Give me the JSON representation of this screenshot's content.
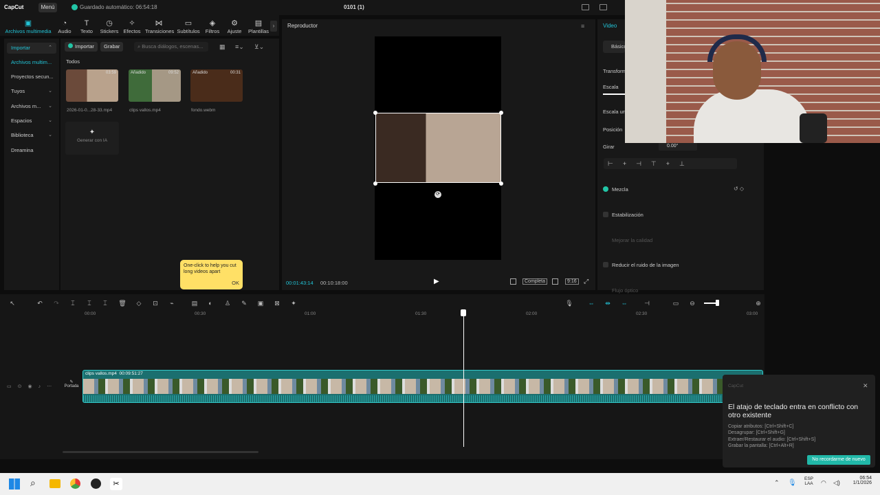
{
  "window": {
    "app_name": "CapCut",
    "menu_label": "Menú",
    "autosave": "Guardado automático: 06:54:18",
    "project_title": "0101 (1)"
  },
  "toolbar": {
    "items": [
      {
        "label": "Archivos multimedia",
        "icon": "media-icon"
      },
      {
        "label": "Audio",
        "icon": "audio-icon"
      },
      {
        "label": "Texto",
        "icon": "text-icon"
      },
      {
        "label": "Stickers",
        "icon": "sticker-icon"
      },
      {
        "label": "Efectos",
        "icon": "effects-icon"
      },
      {
        "label": "Transiciones",
        "icon": "transition-icon"
      },
      {
        "label": "Subtítulos",
        "icon": "subtitles-icon"
      },
      {
        "label": "Filtros",
        "icon": "filter-icon"
      },
      {
        "label": "Ajuste",
        "icon": "adjust-icon"
      },
      {
        "label": "Plantillas",
        "icon": "templates-icon"
      }
    ]
  },
  "sidebar": {
    "items": [
      {
        "label": "Importar"
      },
      {
        "label": "Archivos multim..."
      },
      {
        "label": "Proyectos secun..."
      },
      {
        "label": "Tuyos"
      },
      {
        "label": "Archivos m..."
      },
      {
        "label": "Espacios"
      },
      {
        "label": "Biblioteca"
      },
      {
        "label": "Dreamina"
      }
    ]
  },
  "media": {
    "import_label": "Importar",
    "record_label": "Grabar",
    "search_placeholder": "Busca diálogos, escenas...",
    "filter_label": "Todos",
    "files": [
      {
        "name": "2026-01-0...28-33.mp4",
        "tag": "",
        "duration": "03:59"
      },
      {
        "name": "clips vallos.mp4",
        "tag": "Añadido",
        "duration": "09:52"
      },
      {
        "name": "fondo.webm",
        "tag": "Añadido",
        "duration": "00:31"
      }
    ],
    "ai_label": "Generar con IA"
  },
  "player": {
    "title": "Reproductor",
    "current_time": "00:01:43:14",
    "total_time": "00:10:18:00",
    "complete_label": "Completa",
    "ratio_label": "9:16"
  },
  "right_panel": {
    "tab": "Video",
    "basic_tab": "Básico",
    "transform_label": "Transform",
    "scale_label": "Escala",
    "scale_uniform_label": "Escala un",
    "position_label": "Posición",
    "rotate_label": "Girar",
    "rotate_value": "0.00°",
    "blend_label": "Mezcla",
    "stabilize_label": "Estabilización",
    "improve_label": "Mejorar la calidad",
    "noise_label": "Reducir el ruido de la imagen",
    "flow_label": "Flujo óptico"
  },
  "timeline": {
    "ruler": [
      "00:00",
      "00:30",
      "01:00",
      "01:30",
      "02:00",
      "02:30",
      "03:00"
    ],
    "clip_name": "clips vallos.mp4",
    "clip_duration": "00:09:51:27",
    "cover_label": "Portada"
  },
  "tooltip": {
    "text": "One-click to help you cut long videos apart",
    "ok": "OK"
  },
  "notification": {
    "source": "CapCut",
    "title": "El atajo de teclado entra en conflicto con otro existente",
    "lines": [
      "Copiar atributos: [Ctrl+Shift+C]",
      "Desagrupar: [Ctrl+Shift+G]",
      "Extraer/Restaurar el audio: [Ctrl+Shift+S]",
      "Grabar la pantalla: [Ctrl+Alt+R]"
    ],
    "button": "No recordarme de nuevo"
  },
  "taskbar": {
    "lang": "ESP",
    "lang2": "LAA",
    "time": "06:54",
    "date": "1/1/2026"
  },
  "colors": {
    "accent": "#22c5d8",
    "teal_clip": "#1b6f6f",
    "tooltip": "#ffe066",
    "notif_button": "#21b8a8"
  }
}
